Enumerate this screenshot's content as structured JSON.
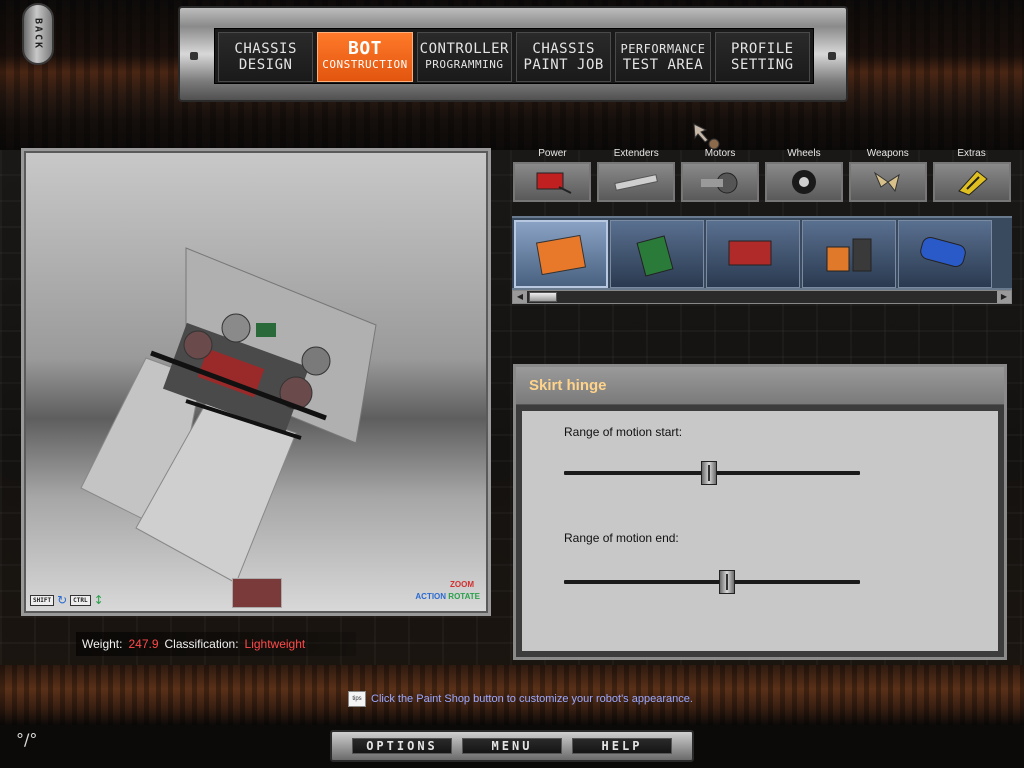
{
  "back_button": {
    "label": "BACK"
  },
  "nav": {
    "tabs": [
      {
        "line1": "CHASSIS",
        "line2": "DESIGN"
      },
      {
        "line1": "BOT",
        "line2": "CONSTRUCTION"
      },
      {
        "line1": "CONTROLLER",
        "line2": "PROGRAMMING"
      },
      {
        "line1": "CHASSIS",
        "line2": "PAINT JOB"
      },
      {
        "line1": "PERFORMANCE",
        "line2": "TEST AREA"
      },
      {
        "line1": "PROFILE",
        "line2": "SETTING"
      }
    ],
    "active_index": 1
  },
  "viewport": {
    "controls": {
      "shift": "SHIFT",
      "ctrl": "CTRL",
      "action": "ACTION",
      "zoom": "ZOOM",
      "rotate": "ROTATE"
    }
  },
  "stats": {
    "weight_label": "Weight:",
    "weight_value": "247.9",
    "class_label": "Classification:",
    "class_value": "Lightweight"
  },
  "categories": [
    {
      "label": "Power",
      "icon": "power-icon"
    },
    {
      "label": "Extenders",
      "icon": "extender-icon"
    },
    {
      "label": "Motors",
      "icon": "motor-icon"
    },
    {
      "label": "Wheels",
      "icon": "wheel-icon"
    },
    {
      "label": "Weapons",
      "icon": "weapon-icon"
    },
    {
      "label": "Extras",
      "icon": "extras-icon"
    }
  ],
  "parts": [
    {
      "icon": "circuit-board-orange-icon",
      "selected": true
    },
    {
      "icon": "circuit-board-green-icon"
    },
    {
      "icon": "red-battery-box-icon"
    },
    {
      "icon": "battery-pair-icon"
    },
    {
      "icon": "blue-puma-canister-icon"
    }
  ],
  "properties": {
    "title": "Skirt hinge",
    "slider_start_label": "Range of motion start:",
    "slider_start_value": 0.49,
    "slider_end_label": "Range of motion end:",
    "slider_end_value": 0.55
  },
  "tip": {
    "icon_label": "tips",
    "text": "Click the Paint Shop button to customize your robot's appearance."
  },
  "bottom_menu": {
    "options": "OPTIONS",
    "menu": "MENU",
    "help": "HELP"
  },
  "colors": {
    "accent_orange": "#f06a1f",
    "red_value": "#ff4a4a",
    "tip_blue": "#9aa8ff",
    "title_peach": "#ffd48a"
  }
}
